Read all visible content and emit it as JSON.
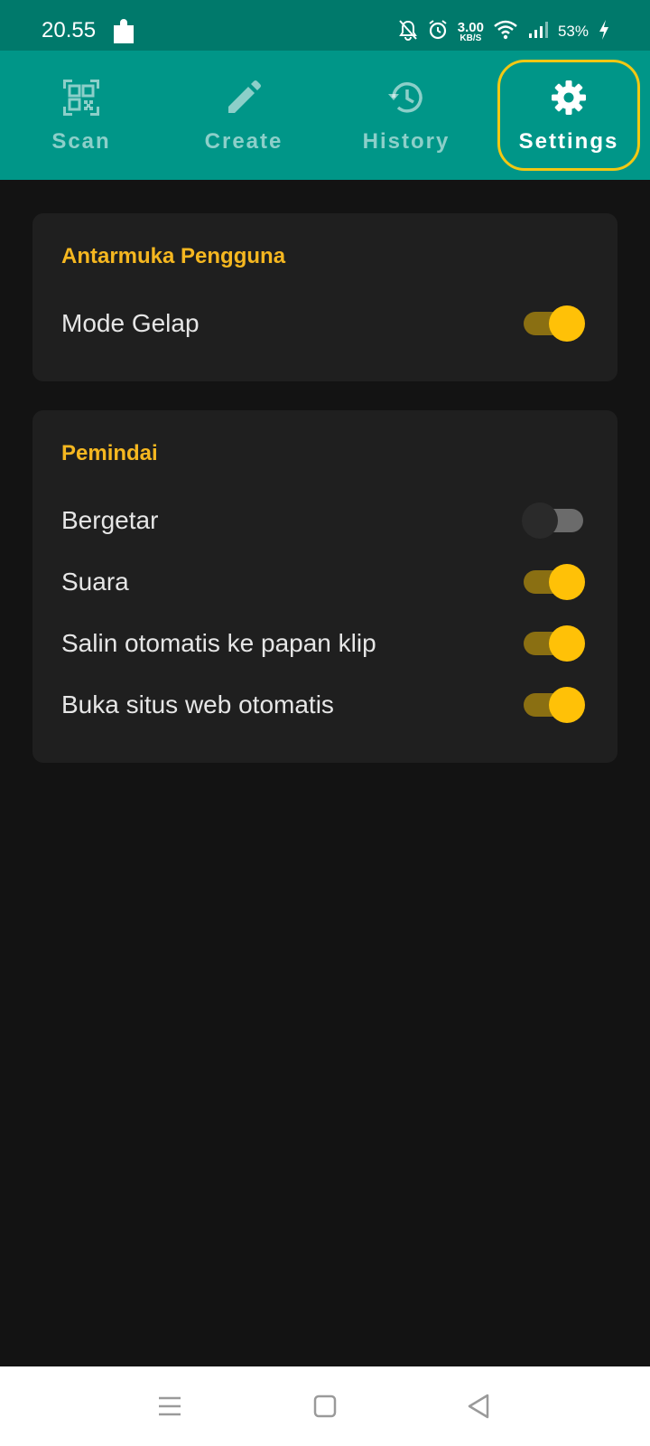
{
  "status_bar": {
    "time": "20.55",
    "net_speed_value": "3.00",
    "net_speed_unit": "KB/S",
    "battery": "53%"
  },
  "tabs": [
    {
      "label": "Scan",
      "icon": "qr-scan-icon",
      "active": false
    },
    {
      "label": "Create",
      "icon": "pencil-icon",
      "active": false
    },
    {
      "label": "History",
      "icon": "history-icon",
      "active": false
    },
    {
      "label": "Settings",
      "icon": "gear-icon",
      "active": true
    }
  ],
  "sections": [
    {
      "title": "Antarmuka Pengguna",
      "items": [
        {
          "label": "Mode Gelap",
          "enabled": true
        }
      ]
    },
    {
      "title": "Pemindai",
      "items": [
        {
          "label": "Bergetar",
          "enabled": false
        },
        {
          "label": "Suara",
          "enabled": true
        },
        {
          "label": "Salin otomatis ke papan klip",
          "enabled": true
        },
        {
          "label": "Buka situs web otomatis",
          "enabled": true
        }
      ]
    }
  ],
  "colors": {
    "status_bar": "#00796b",
    "tab_bar": "#009688",
    "accent": "#f5b720",
    "toggle_on": "#ffc107",
    "background": "#131313",
    "card": "#1f1f1f"
  },
  "nav_bar": [
    "menu-icon",
    "home-square-icon",
    "back-triangle-icon"
  ]
}
